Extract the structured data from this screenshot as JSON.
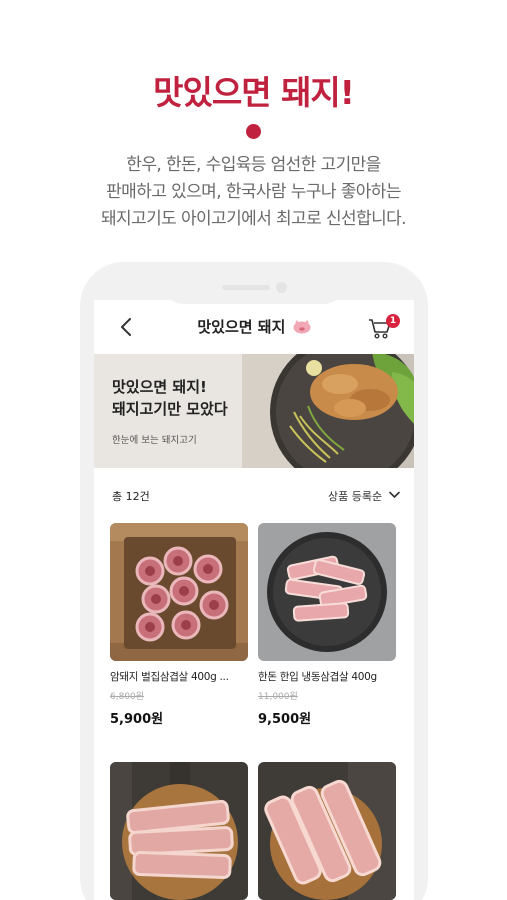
{
  "promo": {
    "headline": "맛있으면 돼지!",
    "description_lines": [
      "한우, 한돈, 수입육등 엄선한 고기만을",
      "판매하고 있으며, 한국사람 누구나 좋아하는",
      "돼지고기도 아이고기에서 최고로 신선합니다."
    ]
  },
  "app": {
    "title": "맛있으면 돼지",
    "cart_count": "1",
    "banner": {
      "line1": "맛있으면 돼지!",
      "line2": "돼지고기만 모았다",
      "subtitle": "한눈에 보는 돼지고기"
    },
    "list": {
      "total": "총 12건",
      "sort": "상품 등록순"
    },
    "products": [
      {
        "name": "암돼지 벌집삼겹살 400g ...",
        "original_price": "6,800원",
        "price": "5,900원"
      },
      {
        "name": "한돈 한입 냉동삼겹살 400g",
        "original_price": "11,000원",
        "price": "9,500원"
      },
      {
        "name": "",
        "original_price": "",
        "price": ""
      },
      {
        "name": "",
        "original_price": "",
        "price": ""
      }
    ]
  },
  "colors": {
    "accent": "#c0213f",
    "badge": "#d8233f",
    "phone_frame": "#f1f1f1",
    "banner_bg": "#e9e6e1"
  },
  "icons": [
    "back-icon",
    "pig-icon",
    "cart-icon",
    "chevron-down-icon"
  ]
}
